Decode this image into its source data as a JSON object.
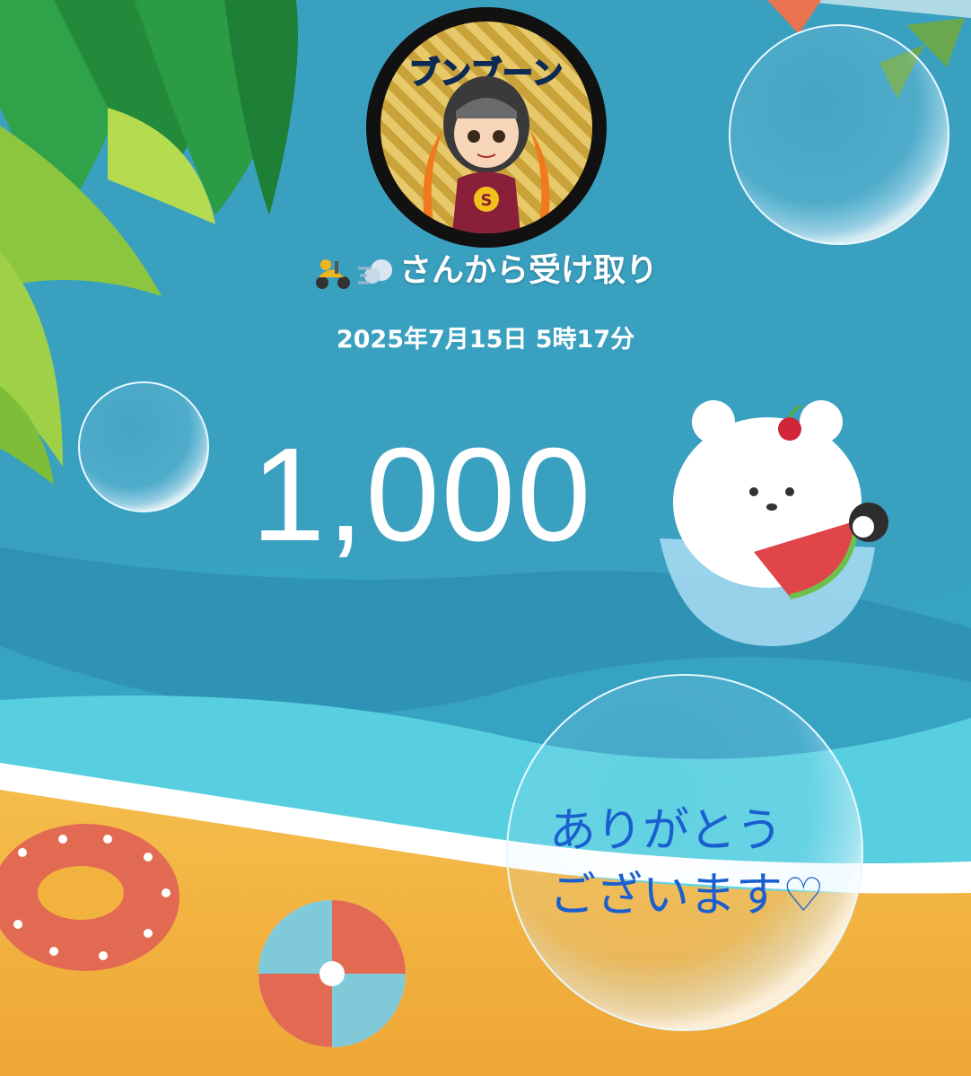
{
  "avatar": {
    "title": "ブンブーン",
    "emblem_letter": "S"
  },
  "sender": {
    "icons": [
      "scooter-icon",
      "dash-icon"
    ],
    "label": "さんから受け取り"
  },
  "received_at": "2025年7月15日 5時17分",
  "amount": "1,000",
  "message": {
    "line1": "ありがとう",
    "line2": "ございます♡"
  },
  "colors": {
    "sea": "#3a9fbf",
    "sand": "#f2b23e",
    "text_blue": "#1a5fd0"
  }
}
